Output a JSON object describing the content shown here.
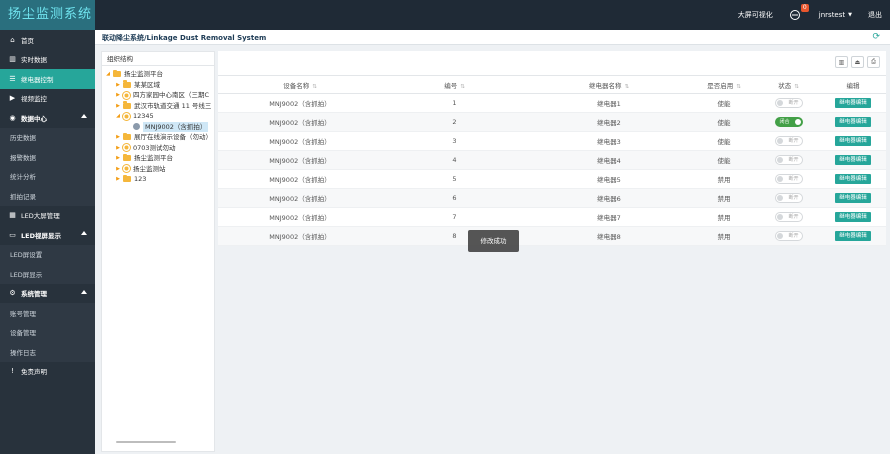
{
  "app": {
    "title": "扬尘监测系统"
  },
  "header": {
    "big_screen_label": "大屏可视化",
    "notification_count": "0",
    "username": "jnrstest",
    "logout_label": "退出"
  },
  "sidebar": {
    "items": [
      {
        "label": "首页",
        "icon": "home-icon"
      },
      {
        "label": "实时数据",
        "icon": "chart-icon"
      },
      {
        "label": "继电器控制",
        "icon": "list-icon",
        "active": true
      },
      {
        "label": "视频监控",
        "icon": "video-icon"
      },
      {
        "label": "数据中心",
        "icon": "gauge-icon"
      },
      {
        "label": "历史数据"
      },
      {
        "label": "报警数据"
      },
      {
        "label": "统计分析"
      },
      {
        "label": "抓拍记录"
      },
      {
        "label": "LED大屏管理",
        "icon": "grid-icon"
      },
      {
        "label": "LED视屏显示",
        "icon": "monitor-icon"
      },
      {
        "label": "LED屏设置"
      },
      {
        "label": "LED屏显示"
      },
      {
        "label": "系统管理",
        "icon": "cogs-icon"
      },
      {
        "label": "账号管理"
      },
      {
        "label": "设备管理"
      },
      {
        "label": "操作日志"
      },
      {
        "label": "免责声明",
        "icon": "exclamation-icon"
      }
    ]
  },
  "breadcrumb": {
    "text": "联动降尘系统/Linkage Dust Removal System"
  },
  "tree": {
    "title": "组织结构",
    "nodes": [
      {
        "label": "扬尘监测平台"
      },
      {
        "label": "某某区域"
      },
      {
        "label": "四方家园中心南区（三期C"
      },
      {
        "label": "武汉市轨道交通 11 号线三"
      },
      {
        "label": "12345"
      },
      {
        "label": "MNJ9002（含抓拍）"
      },
      {
        "label": "展厅在线演示设备（勿动）"
      },
      {
        "label": "0703测试勿动"
      },
      {
        "label": "扬尘监测平台"
      },
      {
        "label": "扬尘监测站"
      },
      {
        "label": "123"
      }
    ]
  },
  "table": {
    "headers": {
      "device": "设备名称",
      "number": "编号",
      "relay": "继电器名称",
      "enabled": "是否启用",
      "status": "状态",
      "edit": "编辑"
    },
    "rows": [
      {
        "device": "MNJ9002（含抓拍）",
        "number": "1",
        "relay": "继电器1",
        "enabled": "使能",
        "status": "断开",
        "on": false,
        "edit": "继电器编辑"
      },
      {
        "device": "MNJ9002（含抓拍）",
        "number": "2",
        "relay": "继电器2",
        "enabled": "使能",
        "status": "闭合",
        "on": true,
        "edit": "继电器编辑"
      },
      {
        "device": "MNJ9002（含抓拍）",
        "number": "3",
        "relay": "继电器3",
        "enabled": "使能",
        "status": "断开",
        "on": false,
        "edit": "继电器编辑"
      },
      {
        "device": "MNJ9002（含抓拍）",
        "number": "4",
        "relay": "继电器4",
        "enabled": "使能",
        "status": "断开",
        "on": false,
        "edit": "继电器编辑"
      },
      {
        "device": "MNJ9002（含抓拍）",
        "number": "5",
        "relay": "继电器5",
        "enabled": "禁用",
        "status": "断开",
        "on": false,
        "edit": "继电器编辑"
      },
      {
        "device": "MNJ9002（含抓拍）",
        "number": "6",
        "relay": "继电器6",
        "enabled": "禁用",
        "status": "断开",
        "on": false,
        "edit": "继电器编辑"
      },
      {
        "device": "MNJ9002（含抓拍）",
        "number": "7",
        "relay": "继电器7",
        "enabled": "禁用",
        "status": "断开",
        "on": false,
        "edit": "继电器编辑"
      },
      {
        "device": "MNJ9002（含抓拍）",
        "number": "8",
        "relay": "继电器8",
        "enabled": "禁用",
        "status": "断开",
        "on": false,
        "edit": "继电器编辑"
      }
    ]
  },
  "toast": {
    "text": "修改成功"
  },
  "colors": {
    "accent": "#26a69a",
    "sidebar": "#28323c",
    "header": "#1f2a36",
    "on": "#43a047"
  }
}
